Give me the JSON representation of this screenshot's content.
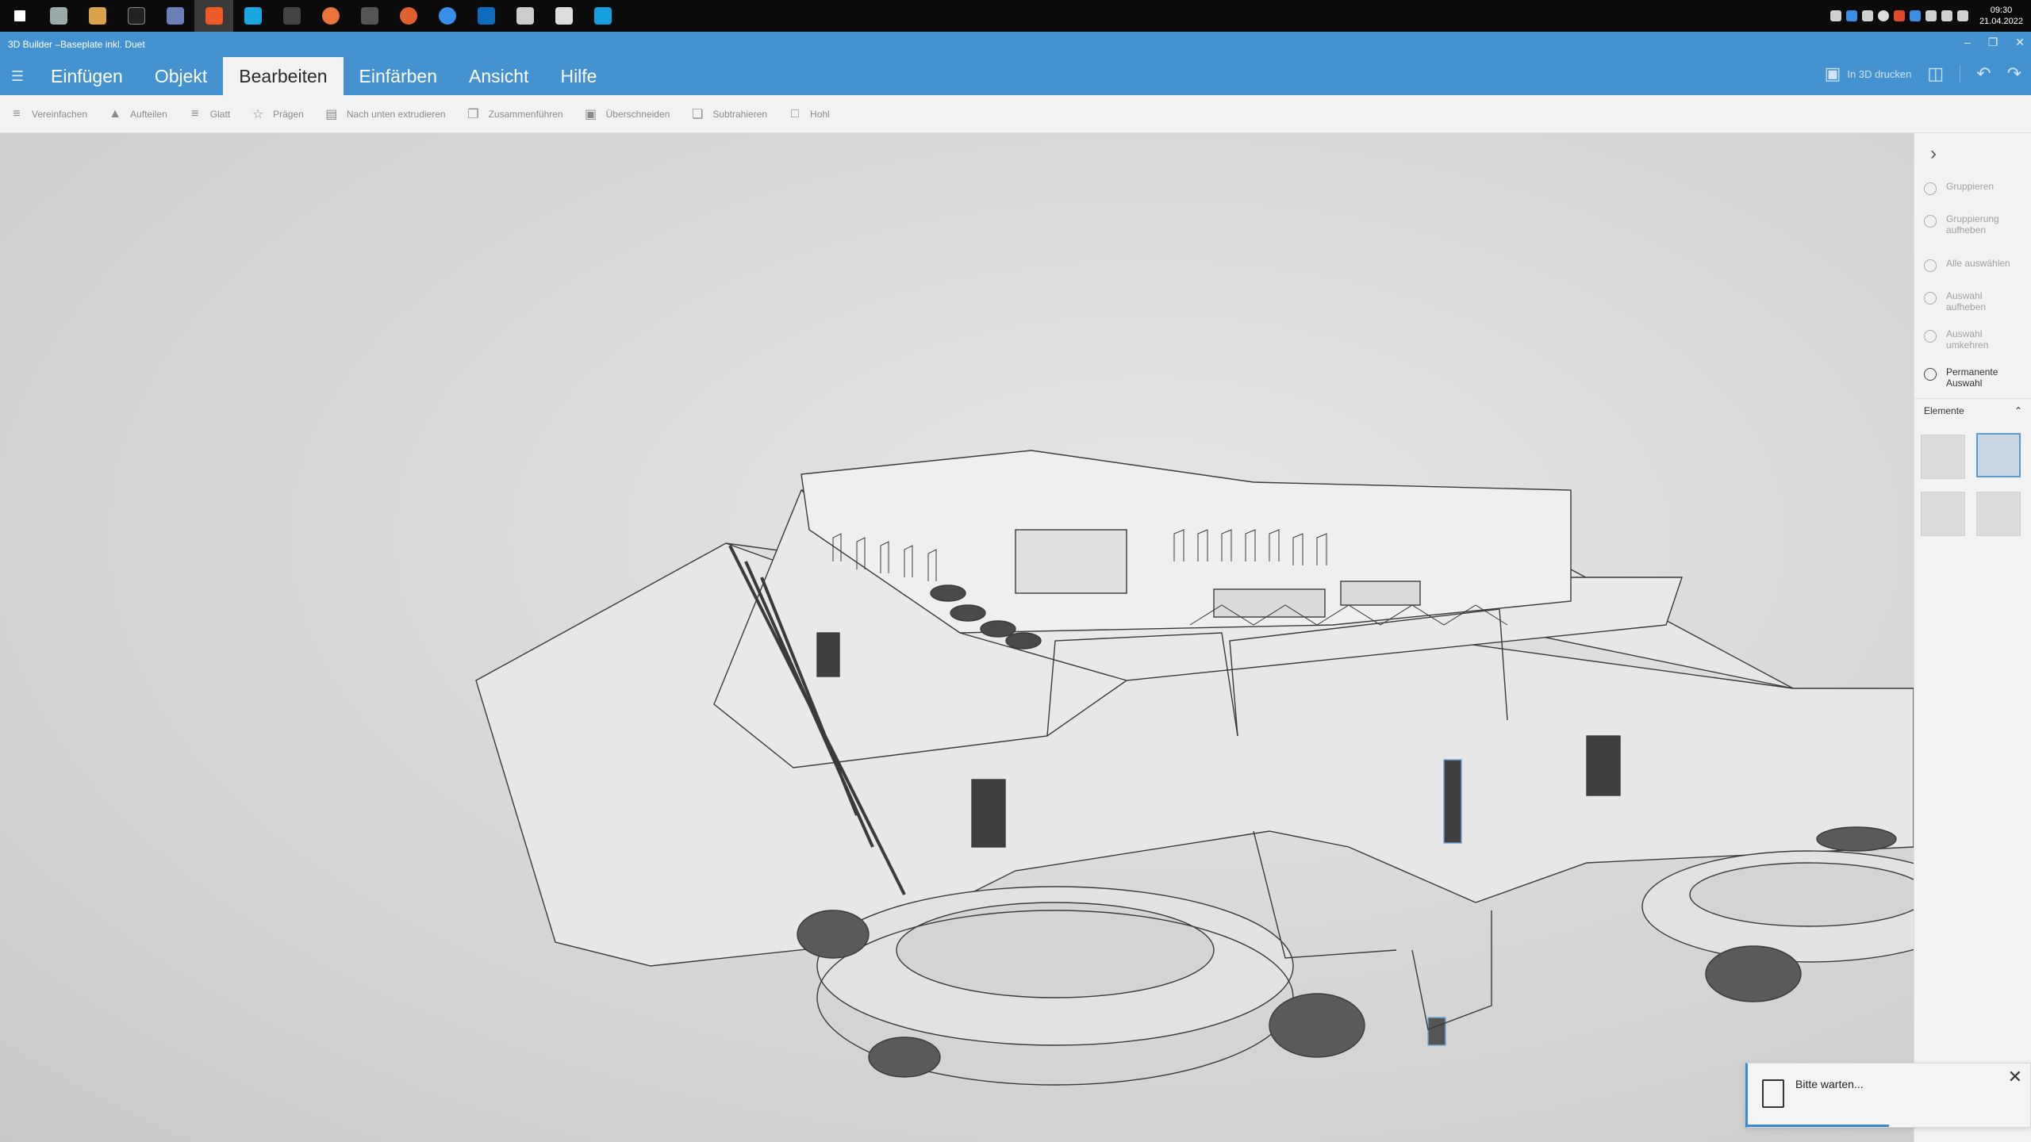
{
  "taskbar": {
    "icons": [
      "windows-start",
      "app-generic",
      "file-explorer",
      "terminal",
      "save-app",
      "brave-browser",
      "c-app",
      "media-app",
      "music-app",
      "grid-app",
      "orange-app",
      "chat-app",
      "outlook",
      "settings-app",
      "excel",
      "n-app"
    ],
    "clock": {
      "time": "09:30",
      "date": "21.04.2022"
    }
  },
  "window": {
    "title": "3D Builder –Baseplate inkl. Duet"
  },
  "menu": {
    "tabs": [
      {
        "label": "Einfügen"
      },
      {
        "label": "Objekt"
      },
      {
        "label": "Bearbeiten",
        "active": true
      },
      {
        "label": "Einfärben"
      },
      {
        "label": "Ansicht"
      },
      {
        "label": "Hilfe"
      }
    ],
    "print_label": "In 3D drucken"
  },
  "toolbar": {
    "items": [
      {
        "label": "Vereinfachen",
        "icon": "simplify-icon"
      },
      {
        "label": "Aufteilen",
        "icon": "split-icon"
      },
      {
        "label": "Glatt",
        "icon": "smooth-icon"
      },
      {
        "label": "Prägen",
        "icon": "emboss-star-icon"
      },
      {
        "label": "Nach unten extrudieren",
        "icon": "extrude-down-icon"
      },
      {
        "label": "Zusammenführen",
        "icon": "merge-icon"
      },
      {
        "label": "Überschneiden",
        "icon": "intersect-icon"
      },
      {
        "label": "Subtrahieren",
        "icon": "subtract-icon"
      },
      {
        "label": "Hohl",
        "icon": "hollow-icon"
      }
    ]
  },
  "right_panel": {
    "actions": [
      {
        "label": "Gruppieren",
        "enabled": false
      },
      {
        "label": "Gruppierung aufheben",
        "enabled": false
      },
      {
        "label": "Alle auswählen",
        "enabled": false
      },
      {
        "label": "Auswahl aufheben",
        "enabled": false
      },
      {
        "label": "Auswahl umkehren",
        "enabled": false
      },
      {
        "label": "Permanente Auswahl",
        "enabled": true
      }
    ],
    "elements_label": "Elemente"
  },
  "toast": {
    "message": "Bitte warten...",
    "progress": 0.5
  }
}
